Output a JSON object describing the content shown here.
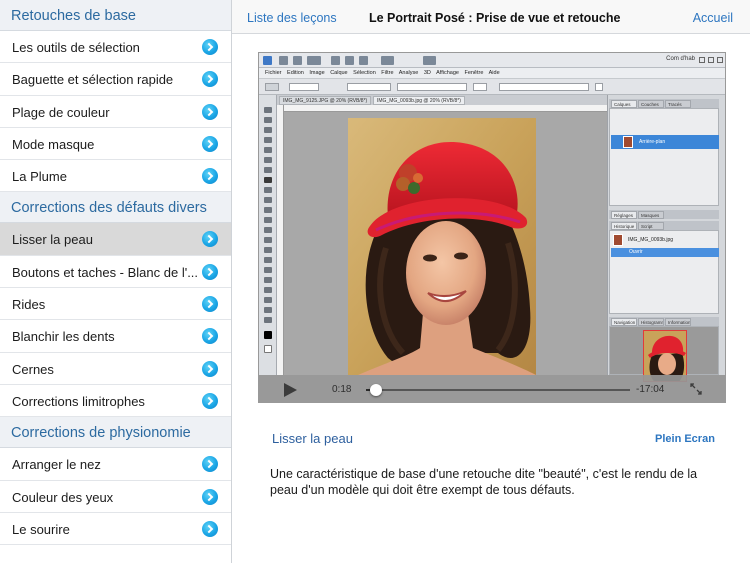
{
  "sidebar": {
    "sections": [
      {
        "title": "Retouches de base",
        "items": [
          {
            "label": "Les outils de sélection"
          },
          {
            "label": "Baguette et sélection rapide"
          },
          {
            "label": "Plage de couleur"
          },
          {
            "label": "Mode masque"
          },
          {
            "label": "La Plume"
          }
        ]
      },
      {
        "title": "Corrections des défauts divers",
        "items": [
          {
            "label": "Lisser la peau",
            "selected": true
          },
          {
            "label": "Boutons et taches - Blanc de l'..."
          },
          {
            "label": "Rides"
          },
          {
            "label": "Blanchir les dents"
          },
          {
            "label": "Cernes"
          },
          {
            "label": "Corrections limitrophes"
          }
        ]
      },
      {
        "title": "Corrections de physionomie",
        "items": [
          {
            "label": "Arranger le nez"
          },
          {
            "label": "Couleur des yeux"
          },
          {
            "label": "Le sourire"
          }
        ]
      }
    ]
  },
  "topnav": {
    "back_label": "Liste des leçons",
    "title": "Le Portrait Posé : Prise de vue et retouche",
    "home_label": "Accueil"
  },
  "video": {
    "ps_menubar": "Fichier Edition Image Calque Sélection Filtre Analyse 3D Affichage Fenêtre Aide",
    "workspace_label": "Com d'hab",
    "tab1_label": "IMG_MG_9125.JPG @ 20% (RVB/8*)",
    "tab2_label": "IMG_MG_0093b.jpg @ 20% (RVB/8*)",
    "layer_label": "Arrière-plan",
    "history_file": "IMG_MG_0093b.jpg",
    "history_step": "Ouvrir",
    "panel_tabs_1": [
      "Calques",
      "Couches",
      "Tracés"
    ],
    "panel_tabs_2": [
      "Réglages",
      "Masques"
    ],
    "panel_tabs_3": [
      "Historique",
      "Script"
    ],
    "panel_tabs_4": [
      "Navigation",
      "Histogramme",
      "Informations"
    ],
    "elapsed": "0:18",
    "remaining": "-17:04",
    "progress": 0.017
  },
  "lesson": {
    "title": "Lisser la peau",
    "fullscreen_label": "Plein Ecran",
    "description": "Une caractéristique de base d'une retouche dite \"beauté\", c'est le rendu de la peau d'un modèle qui doit être exempt de tous défauts."
  },
  "colors": {
    "accent": "#2d76c0",
    "section_header_text": "#2c6aa0",
    "selected_row": "#d9d9d9",
    "hat": "#d81e2c",
    "layer_highlight": "#3c86d8"
  }
}
